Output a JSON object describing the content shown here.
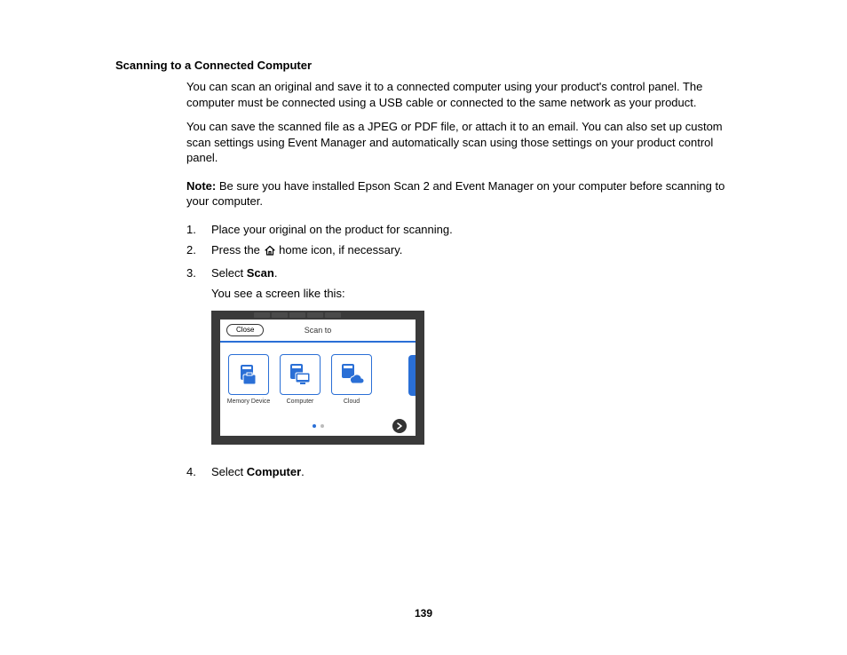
{
  "title": "Scanning to a Connected Computer",
  "p1": "You can scan an original and save it to a connected computer using your product's control panel. The computer must be connected using a USB cable or connected to the same network as your product.",
  "p2": "You can save the scanned file as a JPEG or PDF file, or attach it to an email. You can also set up custom scan settings using Event Manager and automatically scan using those settings on your product control panel.",
  "note_label": "Note:",
  "note_text": " Be sure you have installed Epson Scan 2 and Event Manager on your computer before scanning to your computer.",
  "steps": {
    "s1": "Place your original on the product for scanning.",
    "s2a": "Press the ",
    "s2b": " home icon, if necessary.",
    "s3a": "Select ",
    "s3b": "Scan",
    "s3c": ".",
    "s3_sub": "You see a screen like this:",
    "s4a": "Select ",
    "s4b": "Computer",
    "s4c": "."
  },
  "screenshot": {
    "close": "Close",
    "header": "Scan to",
    "tile1": "Memory Device",
    "tile2": "Computer",
    "tile3": "Cloud"
  },
  "page_number": "139"
}
